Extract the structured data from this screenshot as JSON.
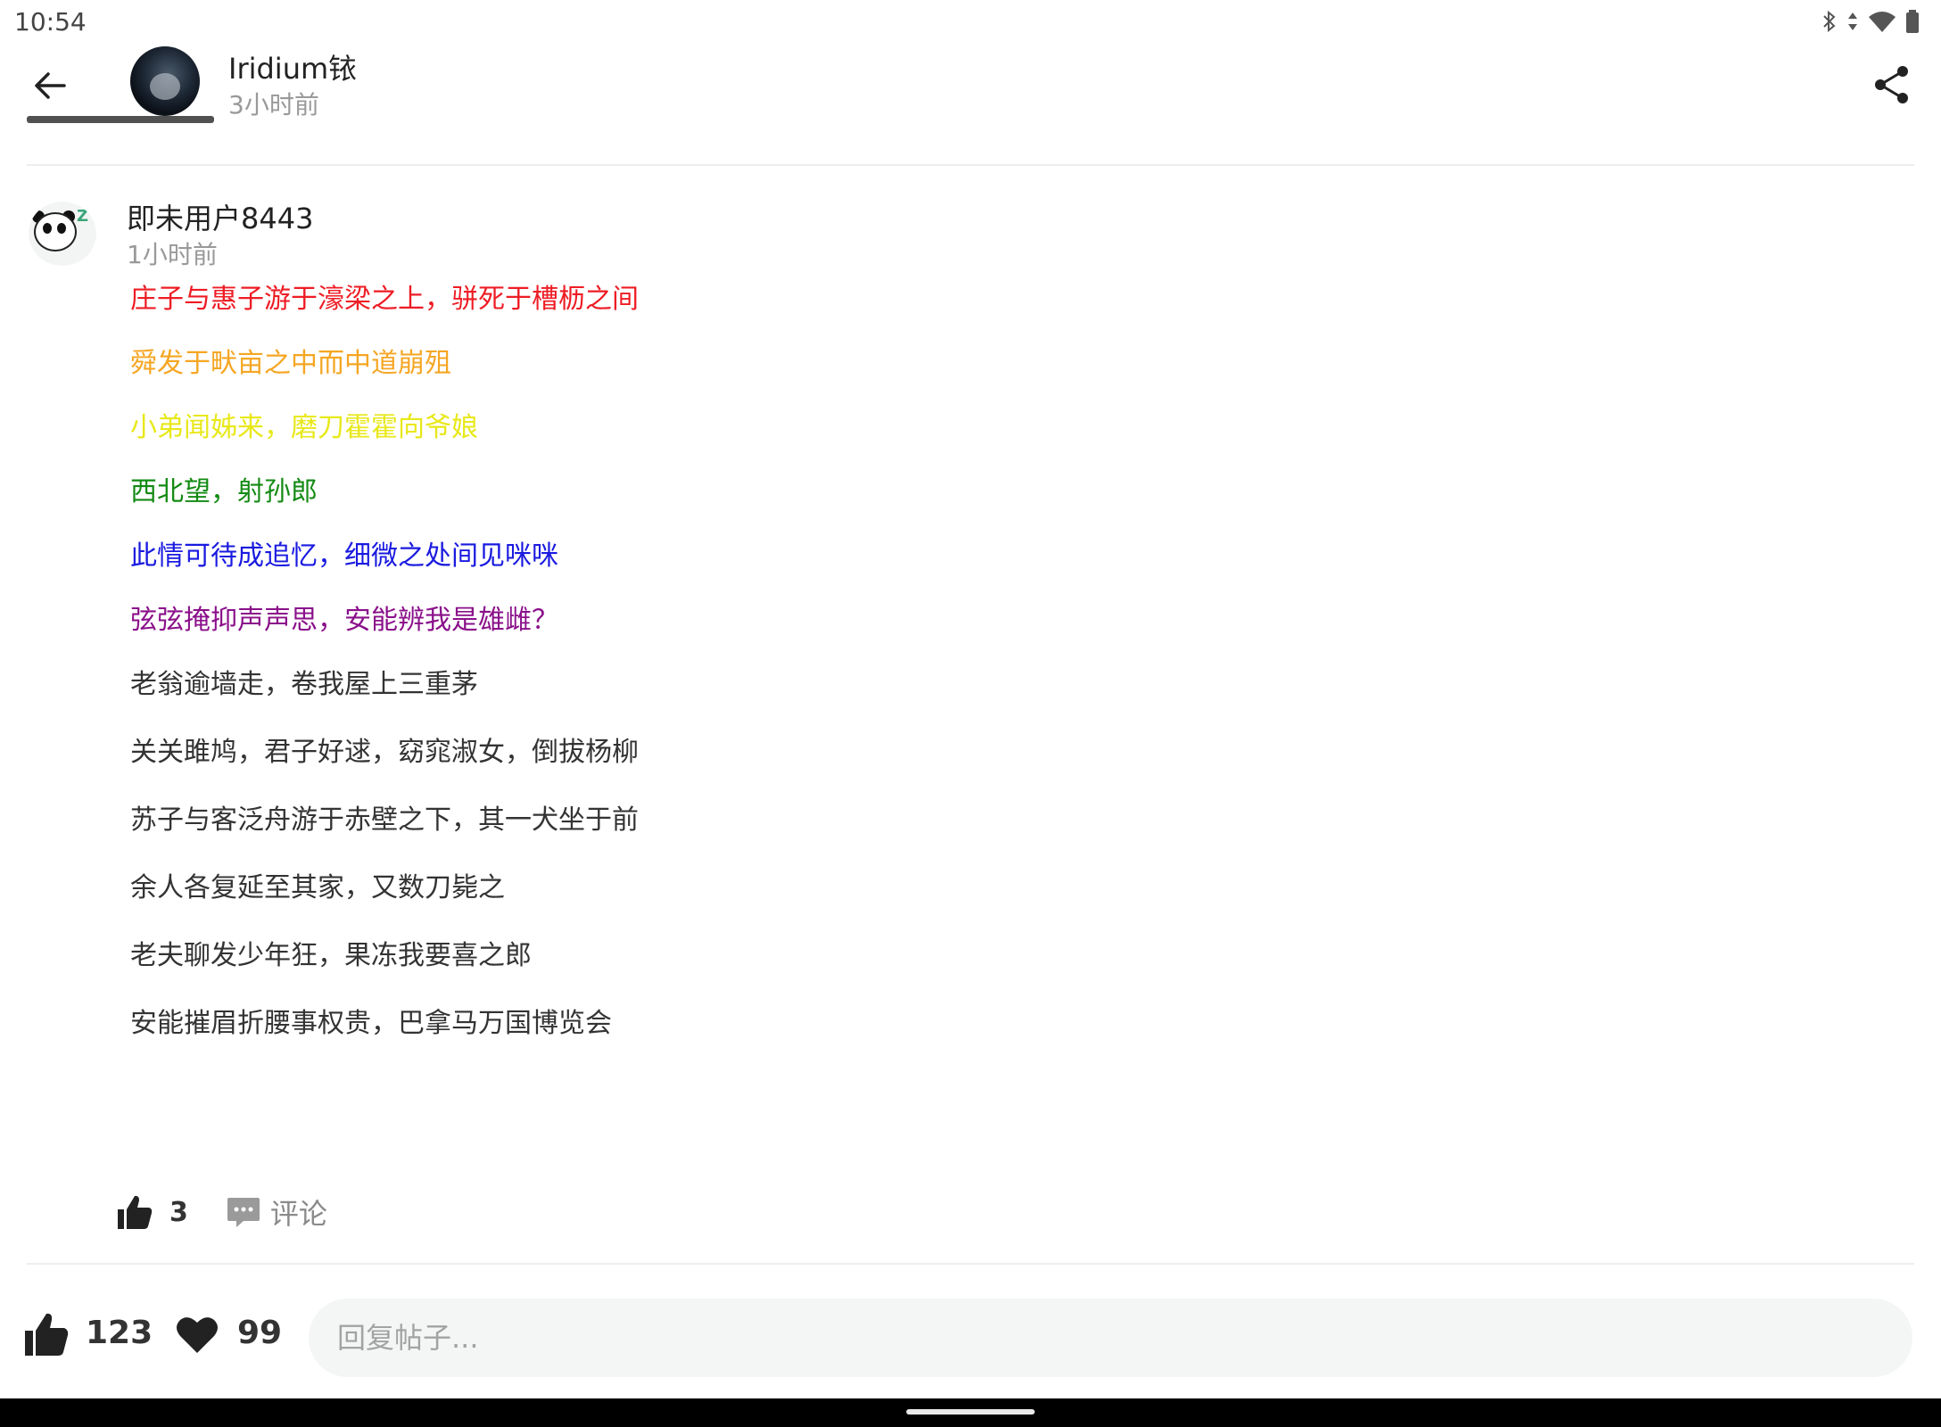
{
  "status_bar": {
    "time": "10:54",
    "icons": [
      "bluetooth-icon",
      "data-arrows-icon",
      "wifi-icon",
      "battery-icon"
    ]
  },
  "header": {
    "author_name": "Iridium铱",
    "post_time": "3小时前",
    "back_icon": "back-arrow-icon",
    "share_icon": "share-icon"
  },
  "comment": {
    "user_name": "即未用户8443",
    "time": "1小时前",
    "lines": [
      {
        "text": "庄子与惠子游于濠梁之上，骈死于槽枥之间",
        "color": "#ee1c24"
      },
      {
        "text": "舜发于畎亩之中而中道崩殂",
        "color": "#f5a623"
      },
      {
        "text": "小弟闻姊来，磨刀霍霍向爷娘",
        "color": "#e8e81a"
      },
      {
        "text": "西北望，射孙郎",
        "color": "#138a13"
      },
      {
        "text": "此情可待成追忆，细微之处间见咪咪",
        "color": "#1a1ae0"
      },
      {
        "text": "弦弦掩抑声声思，安能辨我是雄雌？",
        "color": "#8a108a"
      },
      {
        "text": "老翁逾墙走，卷我屋上三重茅",
        "color": "#333333"
      },
      {
        "text": "关关雎鸠，君子好逑，窈窕淑女，倒拔杨柳",
        "color": "#333333"
      },
      {
        "text": "苏子与客泛舟游于赤壁之下，其一犬坐于前",
        "color": "#333333"
      },
      {
        "text": "余人各复延至其家，又数刀毙之",
        "color": "#333333"
      },
      {
        "text": "老夫聊发少年狂，果冻我要喜之郎",
        "color": "#333333"
      },
      {
        "text": "安能摧眉折腰事权贵，巴拿马万国博览会",
        "color": "#333333"
      }
    ],
    "likes": "3",
    "comment_label": "评论"
  },
  "bottom_bar": {
    "likes": "123",
    "favorites": "99",
    "reply_placeholder": "回复帖子..."
  }
}
